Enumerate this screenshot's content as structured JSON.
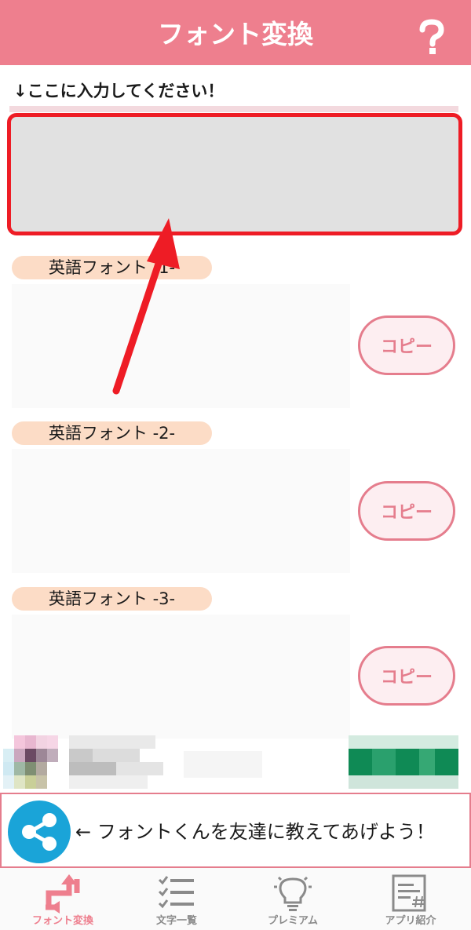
{
  "header": {
    "title": "フォント変換",
    "help_icon": "question-mark-icon"
  },
  "instruction": "↓ここに入力してください！",
  "fonts": [
    {
      "label": "英語フォント -1-",
      "copy_label": "コピー"
    },
    {
      "label": "英語フォント -2-",
      "copy_label": "コピー"
    },
    {
      "label": "英語フォント -3-",
      "copy_label": "コピー"
    }
  ],
  "share": {
    "text": "← フォントくんを友達に教えてあげよう！",
    "icon": "share-icon"
  },
  "tabs": [
    {
      "label": "フォント変換",
      "icon": "convert-arrows-icon",
      "active": true
    },
    {
      "label": "文字一覧",
      "icon": "checklist-icon",
      "active": false
    },
    {
      "label": "プレミアム",
      "icon": "lightbulb-icon",
      "active": false
    },
    {
      "label": "アプリ紹介",
      "icon": "document-hash-icon",
      "active": false
    }
  ],
  "colors": {
    "accent": "#ee7f8e",
    "highlight_red": "#ee1c25",
    "label_bg": "#fcdcc6",
    "share_blue": "#1aa4d8"
  }
}
